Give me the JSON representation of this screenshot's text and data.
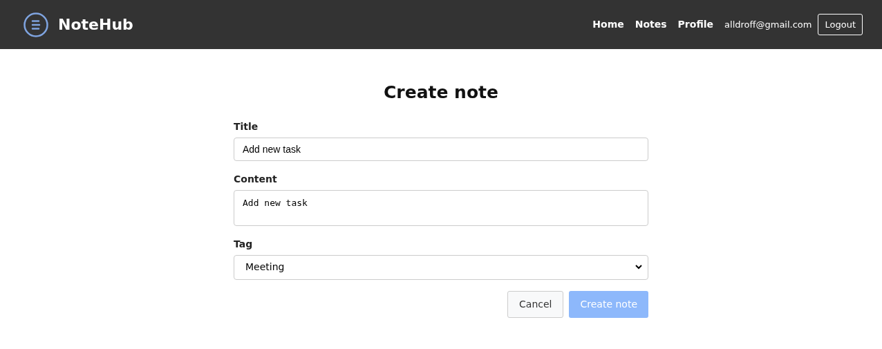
{
  "header": {
    "brand": "NoteHub",
    "nav": [
      {
        "label": "Home"
      },
      {
        "label": "Notes"
      },
      {
        "label": "Profile"
      }
    ],
    "user_email": "alldroff@gmail.com",
    "logout": "Logout"
  },
  "form": {
    "heading": "Create note",
    "fields": [
      {
        "kind": "input",
        "label": "Title",
        "value": "Add new task"
      },
      {
        "kind": "textarea",
        "label": "Content",
        "value": "Add new task"
      },
      {
        "kind": "select",
        "label": "Tag",
        "value": "Meeting"
      }
    ],
    "cancel": "Cancel",
    "submit": {
      "label": "Create note",
      "disabled": true
    }
  }
}
